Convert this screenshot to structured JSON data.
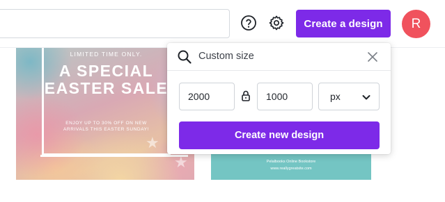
{
  "header": {
    "search_value": "",
    "create_design_label": "Create a design",
    "help_icon": "help-circle-icon",
    "settings_icon": "gear-icon",
    "avatar_initial": "R",
    "brand_color": "#7d2ae8",
    "avatar_color": "#f0525d"
  },
  "designs": [
    {
      "eyebrow": "LIMITED TIME ONLY.",
      "title": "A SPECIAL EASTER SALE",
      "subtitle": "ENJOY UP TO 30% OFF ON NEW ARRIVALS THIS EASTER SUNDAY!"
    },
    {
      "line1": "Pelalbooks Online Bookstore",
      "line2": "www.reallygreatsite.com"
    }
  ],
  "custom_size_popover": {
    "search_text": "Custom size",
    "close_icon": "close-icon",
    "width_value": "2000",
    "height_value": "1000",
    "lock_icon": "lock-icon",
    "unit_value": "px",
    "create_new_label": "Create new design"
  }
}
